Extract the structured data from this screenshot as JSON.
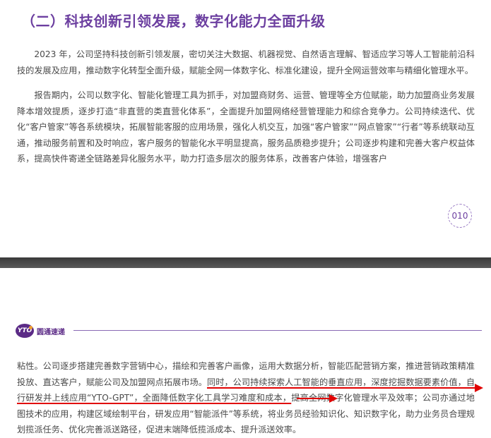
{
  "top_page": {
    "section_title": "（二）科技创新引领发展，数字化能力全面升级",
    "paragraph_1": "2023 年，公司坚持科技创新引领发展，密切关注大数据、机器视觉、自然语言理解、智适应学习等人工智能前沿科技的发展及应用，推动数字化转型全面升级，赋能全网一体数字化、标准化建设，提升全网运营效率与精细化管理水平。",
    "paragraph_2": "报告期内，公司以数字化、智能化管理工具为抓手，对加盟商财务、运营、管理等全方位赋能，助力加盟商业务发展降本增效提质，逐步打造“非直营的类直营化体系”，全面提升加盟网络经营管理能力和综合竞争力。公司持续迭代、优化“客户管家”等各系统模块，拓展智能客服的应用场景，强化人机交互，加强“客户管家”“网点管家”“行者”等系统联动互通，推动服务前置和及时响应，客户服务的智能化水平明显提高，服务品质稳步提升；公司逐步构建和完善大客户权益体系，提高快件寄递全链路差异化服务水平，助力打造多层次的服务体系，改善客户体验，增强客户",
    "page_number": "010"
  },
  "bottom_page": {
    "logo_mark": "YTO",
    "logo_text": "圆通速递",
    "paragraph_3_part_a": "粘性。公司逐步搭建完善数字营销中心，描绘和完善客户画像，运用大数据分析，智能匹配营销方案，推进营销政策精准投放、直达客户，赋能公司及加盟网点拓展市场。",
    "paragraph_3_highlight": "同时，公司持续探索人工智能的垂直应用，深度挖掘数据要素价值，自行研发并上线应用“YTO-GPT”，全面降低数字化工具学习难度和成本，",
    "paragraph_3_part_b": "提高全网数字化管理水平及效率；公司亦通过地图技术的应用，构建区域绘制平台，研发应用“智能派件”等系统，将业务员经验知识化、知识数字化，助力业务员合理规划揽派任务、优化完善派送路径，促进末端降低揽派成本、提升派送效率。"
  },
  "colors": {
    "title_purple": "#6c3fa0",
    "annotation_red": "#e00000",
    "divider_dark": "#3a3a3a"
  }
}
